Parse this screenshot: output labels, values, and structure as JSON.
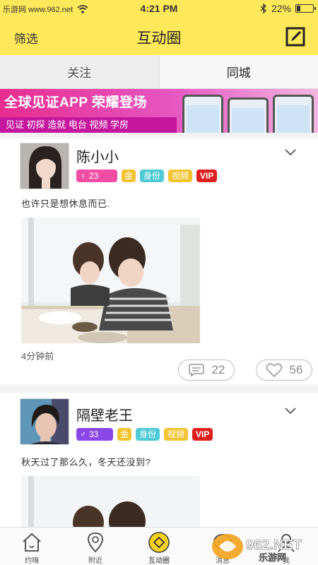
{
  "status_bar": {
    "carrier": "乐游网 www.962.net",
    "time": "4:21 PM",
    "battery": "22%",
    "battery_level": 0.22
  },
  "nav": {
    "filter_label": "筛选",
    "title": "互动圈",
    "edit_icon": "edit-icon"
  },
  "tabs": [
    {
      "label": "关注",
      "active": false
    },
    {
      "label": "同城",
      "active": true
    }
  ],
  "banner": {
    "title": "全球见证APP 荣耀登场",
    "subtitle": "见证 初探 造就 电台 视频 学房"
  },
  "posts": [
    {
      "username": "陈小小",
      "gender_symbol": "♀",
      "age": "23",
      "badges": [
        "金",
        "身份",
        "视频",
        "VIP"
      ],
      "text": "也许只是想休息而已.",
      "time": "4分钟前",
      "comments": "22",
      "likes": "56"
    },
    {
      "username": "隔壁老王",
      "gender_symbol": "♂",
      "age": "33",
      "badges": [
        "金",
        "身份",
        "视频",
        "VIP"
      ],
      "text": "秋天过了那么久，冬天还没到?"
    }
  ],
  "tab_bar": [
    {
      "label": "约嗨",
      "icon": "home-icon"
    },
    {
      "label": "附近",
      "icon": "location-icon"
    },
    {
      "label": "互动圈",
      "icon": "interaction-icon",
      "active": true
    },
    {
      "label": "消息",
      "icon": "message-icon"
    },
    {
      "label": "我",
      "icon": "profile-icon"
    }
  ],
  "watermark": "962.NET 乐游网",
  "colors": {
    "accent": "#ffe95a",
    "female": "#f24ca4",
    "male": "#8a46e6",
    "vip": "#e0201e",
    "gold": "#f1c330",
    "id": "#4fcbd6"
  }
}
